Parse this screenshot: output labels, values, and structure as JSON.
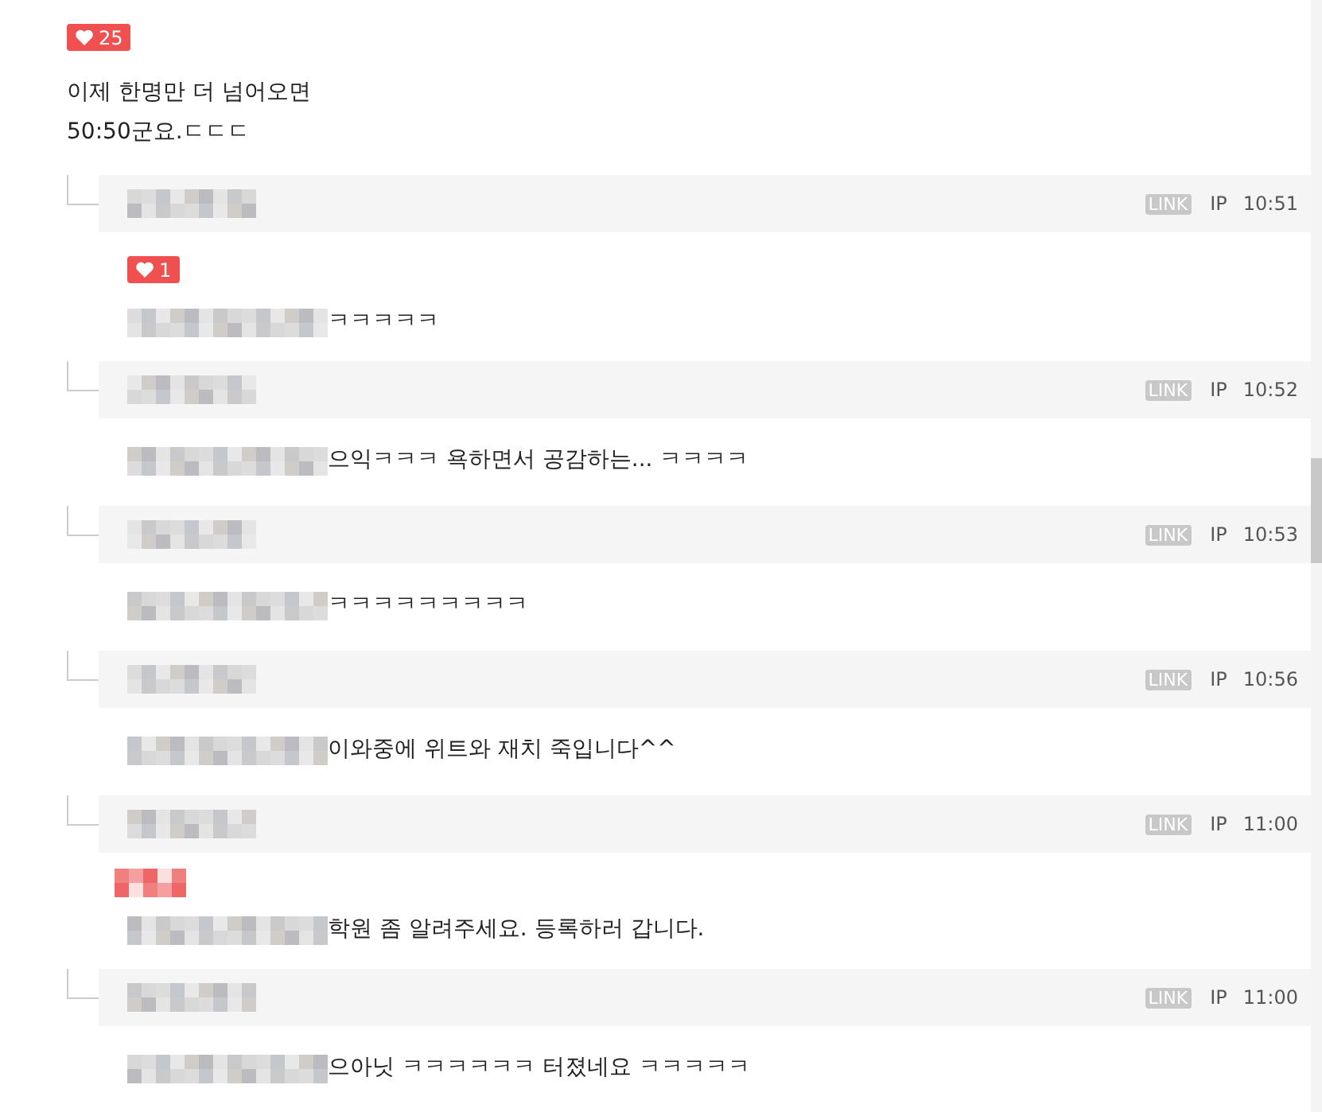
{
  "comment": {
    "likes": "25",
    "lines": [
      "이제 한명만 더 넘어오면",
      "50:50군요.ㄷㄷㄷ"
    ]
  },
  "replies": [
    {
      "link": "LINK",
      "ip": "IP",
      "time": "10:51",
      "badge": {
        "kind": "count",
        "text": "1"
      },
      "text": "ㅋㅋㅋㅋㅋ"
    },
    {
      "link": "LINK",
      "ip": "IP",
      "time": "10:52",
      "text": "으익ㅋㅋㅋ 욕하면서 공감하는... ㅋㅋㅋㅋ"
    },
    {
      "link": "LINK",
      "ip": "IP",
      "time": "10:53",
      "text": "ㅋㅋㅋㅋㅋㅋㅋㅋㅋ"
    },
    {
      "link": "LINK",
      "ip": "IP",
      "time": "10:56",
      "text": "이와중에 위트와 재치 죽입니다^^"
    },
    {
      "link": "LINK",
      "ip": "IP",
      "time": "11:00",
      "badge": {
        "kind": "blurred"
      },
      "text": "학원 좀 알려주세요. 등록하러 갑니다."
    },
    {
      "link": "LINK",
      "ip": "IP",
      "time": "11:00",
      "text": "으아닛 ㅋㅋㅋㅋㅋㅋ 터졌네요 ㅋㅋㅋㅋㅋ"
    }
  ]
}
